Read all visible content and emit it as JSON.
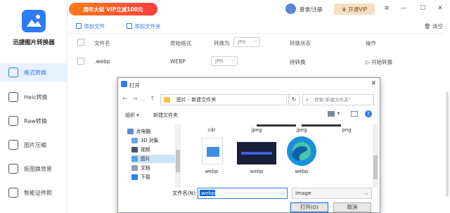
{
  "app": {
    "name": "迅捷图片转换器",
    "promo": "周年大促 VIP立减100元",
    "login": "登录/注册",
    "vip": "开通VIP"
  },
  "sidebar": {
    "items": [
      {
        "label": "格式转换",
        "active": true
      },
      {
        "label": "Heic转换"
      },
      {
        "label": "Raw转换"
      },
      {
        "label": "图片压缩"
      },
      {
        "label": "抠图换背景"
      },
      {
        "label": "智能证件照"
      }
    ]
  },
  "toolbar": {
    "add_file": "添加文件",
    "add_folder": "添加文件夹",
    "clear": "清空"
  },
  "table": {
    "headers": [
      "文件名",
      "原始格式",
      "转换为",
      "转换状态",
      "操作"
    ],
    "header_select": "JPG",
    "row": {
      "name": ".webp",
      "format": "WEBP",
      "target": "JPG",
      "status": "待转换",
      "action": "开始转换"
    }
  },
  "dialog": {
    "title": "打开",
    "breadcrumb": [
      "图片",
      "新建文件夹"
    ],
    "search_placeholder": "搜索\"新建文件夹\"",
    "organize": "组织",
    "new_folder": "新建文件夹",
    "tree": [
      "此电脑",
      "3D 对象",
      "视频",
      "图片",
      "文档",
      "下载"
    ],
    "files": [
      {
        "name": "cdr"
      },
      {
        "name": "jpeg"
      },
      {
        "name": "jpeg"
      },
      {
        "name": "png"
      },
      {
        "name": "webp"
      },
      {
        "name": "webp"
      },
      {
        "name": "webp"
      }
    ],
    "filename_label": "文件名(N):",
    "filename_value": ".webp",
    "filetype": "Image",
    "open": "打开(O)",
    "cancel": "取消"
  },
  "colors": {
    "accent": "#2e7cf6",
    "promo_start": "#ff7a1a",
    "promo_end": "#ff3d3d",
    "vip_bg": "#f5dfc0"
  }
}
